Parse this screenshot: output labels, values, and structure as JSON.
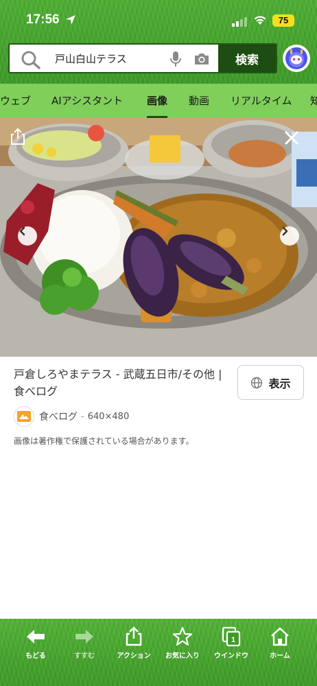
{
  "status_bar": {
    "time": "17:56",
    "battery": "75"
  },
  "search": {
    "query": "戸山白山テラス",
    "button_label": "検索"
  },
  "tabs": [
    {
      "label": "ウェブ",
      "active": false
    },
    {
      "label": "AIアシスタント",
      "active": false
    },
    {
      "label": "画像",
      "active": true
    },
    {
      "label": "動画",
      "active": false
    },
    {
      "label": "リアルタイム",
      "active": false
    },
    {
      "label": "知",
      "active": false
    }
  ],
  "result": {
    "title": "戸倉しろやまテラス - 武蔵五日市/その他 | 食べログ",
    "view_button_label": "表示",
    "source_name": "食べログ",
    "separator": "-",
    "image_size": "640×480",
    "copyright_notice": "画像は著作権で保護されている場合があります。"
  },
  "toolbar": {
    "items": [
      {
        "label": "もどる",
        "icon": "back-arrow-icon",
        "enabled": true
      },
      {
        "label": "すすむ",
        "icon": "forward-arrow-icon",
        "enabled": false
      },
      {
        "label": "アクション",
        "icon": "share-icon",
        "enabled": true
      },
      {
        "label": "お気に入り",
        "icon": "star-icon",
        "enabled": true
      },
      {
        "label": "ウインドウ",
        "icon": "windows-icon",
        "enabled": true,
        "badge": "1"
      },
      {
        "label": "ホーム",
        "icon": "home-icon",
        "enabled": true
      }
    ]
  },
  "colors": {
    "header_green": "#4fae34",
    "tab_green": "#7fcf5a",
    "search_button": "#1d4d12",
    "battery_yellow": "#f5df1c"
  }
}
